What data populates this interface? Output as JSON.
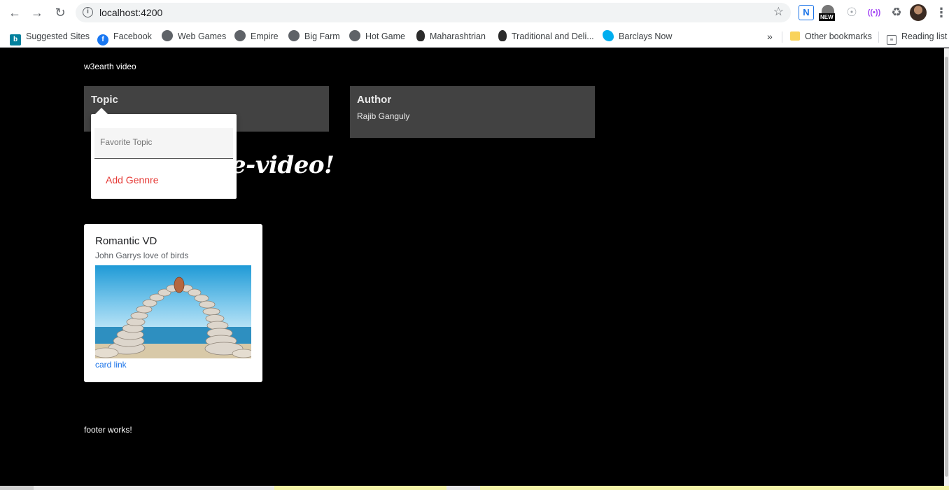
{
  "browser": {
    "url": "localhost:4200",
    "extensions": {
      "n_label": "N",
      "new_badge": "NEW",
      "cast_label": "((•))"
    },
    "bookmarks": [
      {
        "label": "Suggested Sites",
        "icon": "bing-icon",
        "glyph": "b"
      },
      {
        "label": "Facebook",
        "icon": "facebook-icon",
        "glyph": "f"
      },
      {
        "label": "Web Games",
        "icon": "globe-icon",
        "glyph": ""
      },
      {
        "label": "Empire",
        "icon": "globe-icon",
        "glyph": ""
      },
      {
        "label": "Big Farm",
        "icon": "globe-icon",
        "glyph": ""
      },
      {
        "label": "Hot Game",
        "icon": "globe-icon",
        "glyph": ""
      },
      {
        "label": "Maharashtrian",
        "icon": "face-icon",
        "glyph": ""
      },
      {
        "label": "Traditional and Deli...",
        "icon": "face-icon",
        "glyph": ""
      },
      {
        "label": "Barclays Now",
        "icon": "barclays-icon",
        "glyph": ""
      }
    ],
    "overflow": "»",
    "other_bookmarks": "Other bookmarks",
    "reading_list": "Reading list"
  },
  "page": {
    "brand": "w3earth video",
    "topic_panel": {
      "title": "Topic"
    },
    "author_panel": {
      "title": "Author",
      "value": "Rajib Ganguly"
    },
    "headline_visible": "e-video!",
    "popover": {
      "placeholder": "Favorite Topic",
      "button": "Add Gennre"
    },
    "card": {
      "title": "Romantic VD",
      "subtitle": "John Garrys love of birds",
      "link": "card link"
    },
    "footer": "footer works!"
  },
  "colors": {
    "background": "#000000",
    "panel": "#424242",
    "accent_button": "#e53935",
    "link": "#1a73e8"
  }
}
